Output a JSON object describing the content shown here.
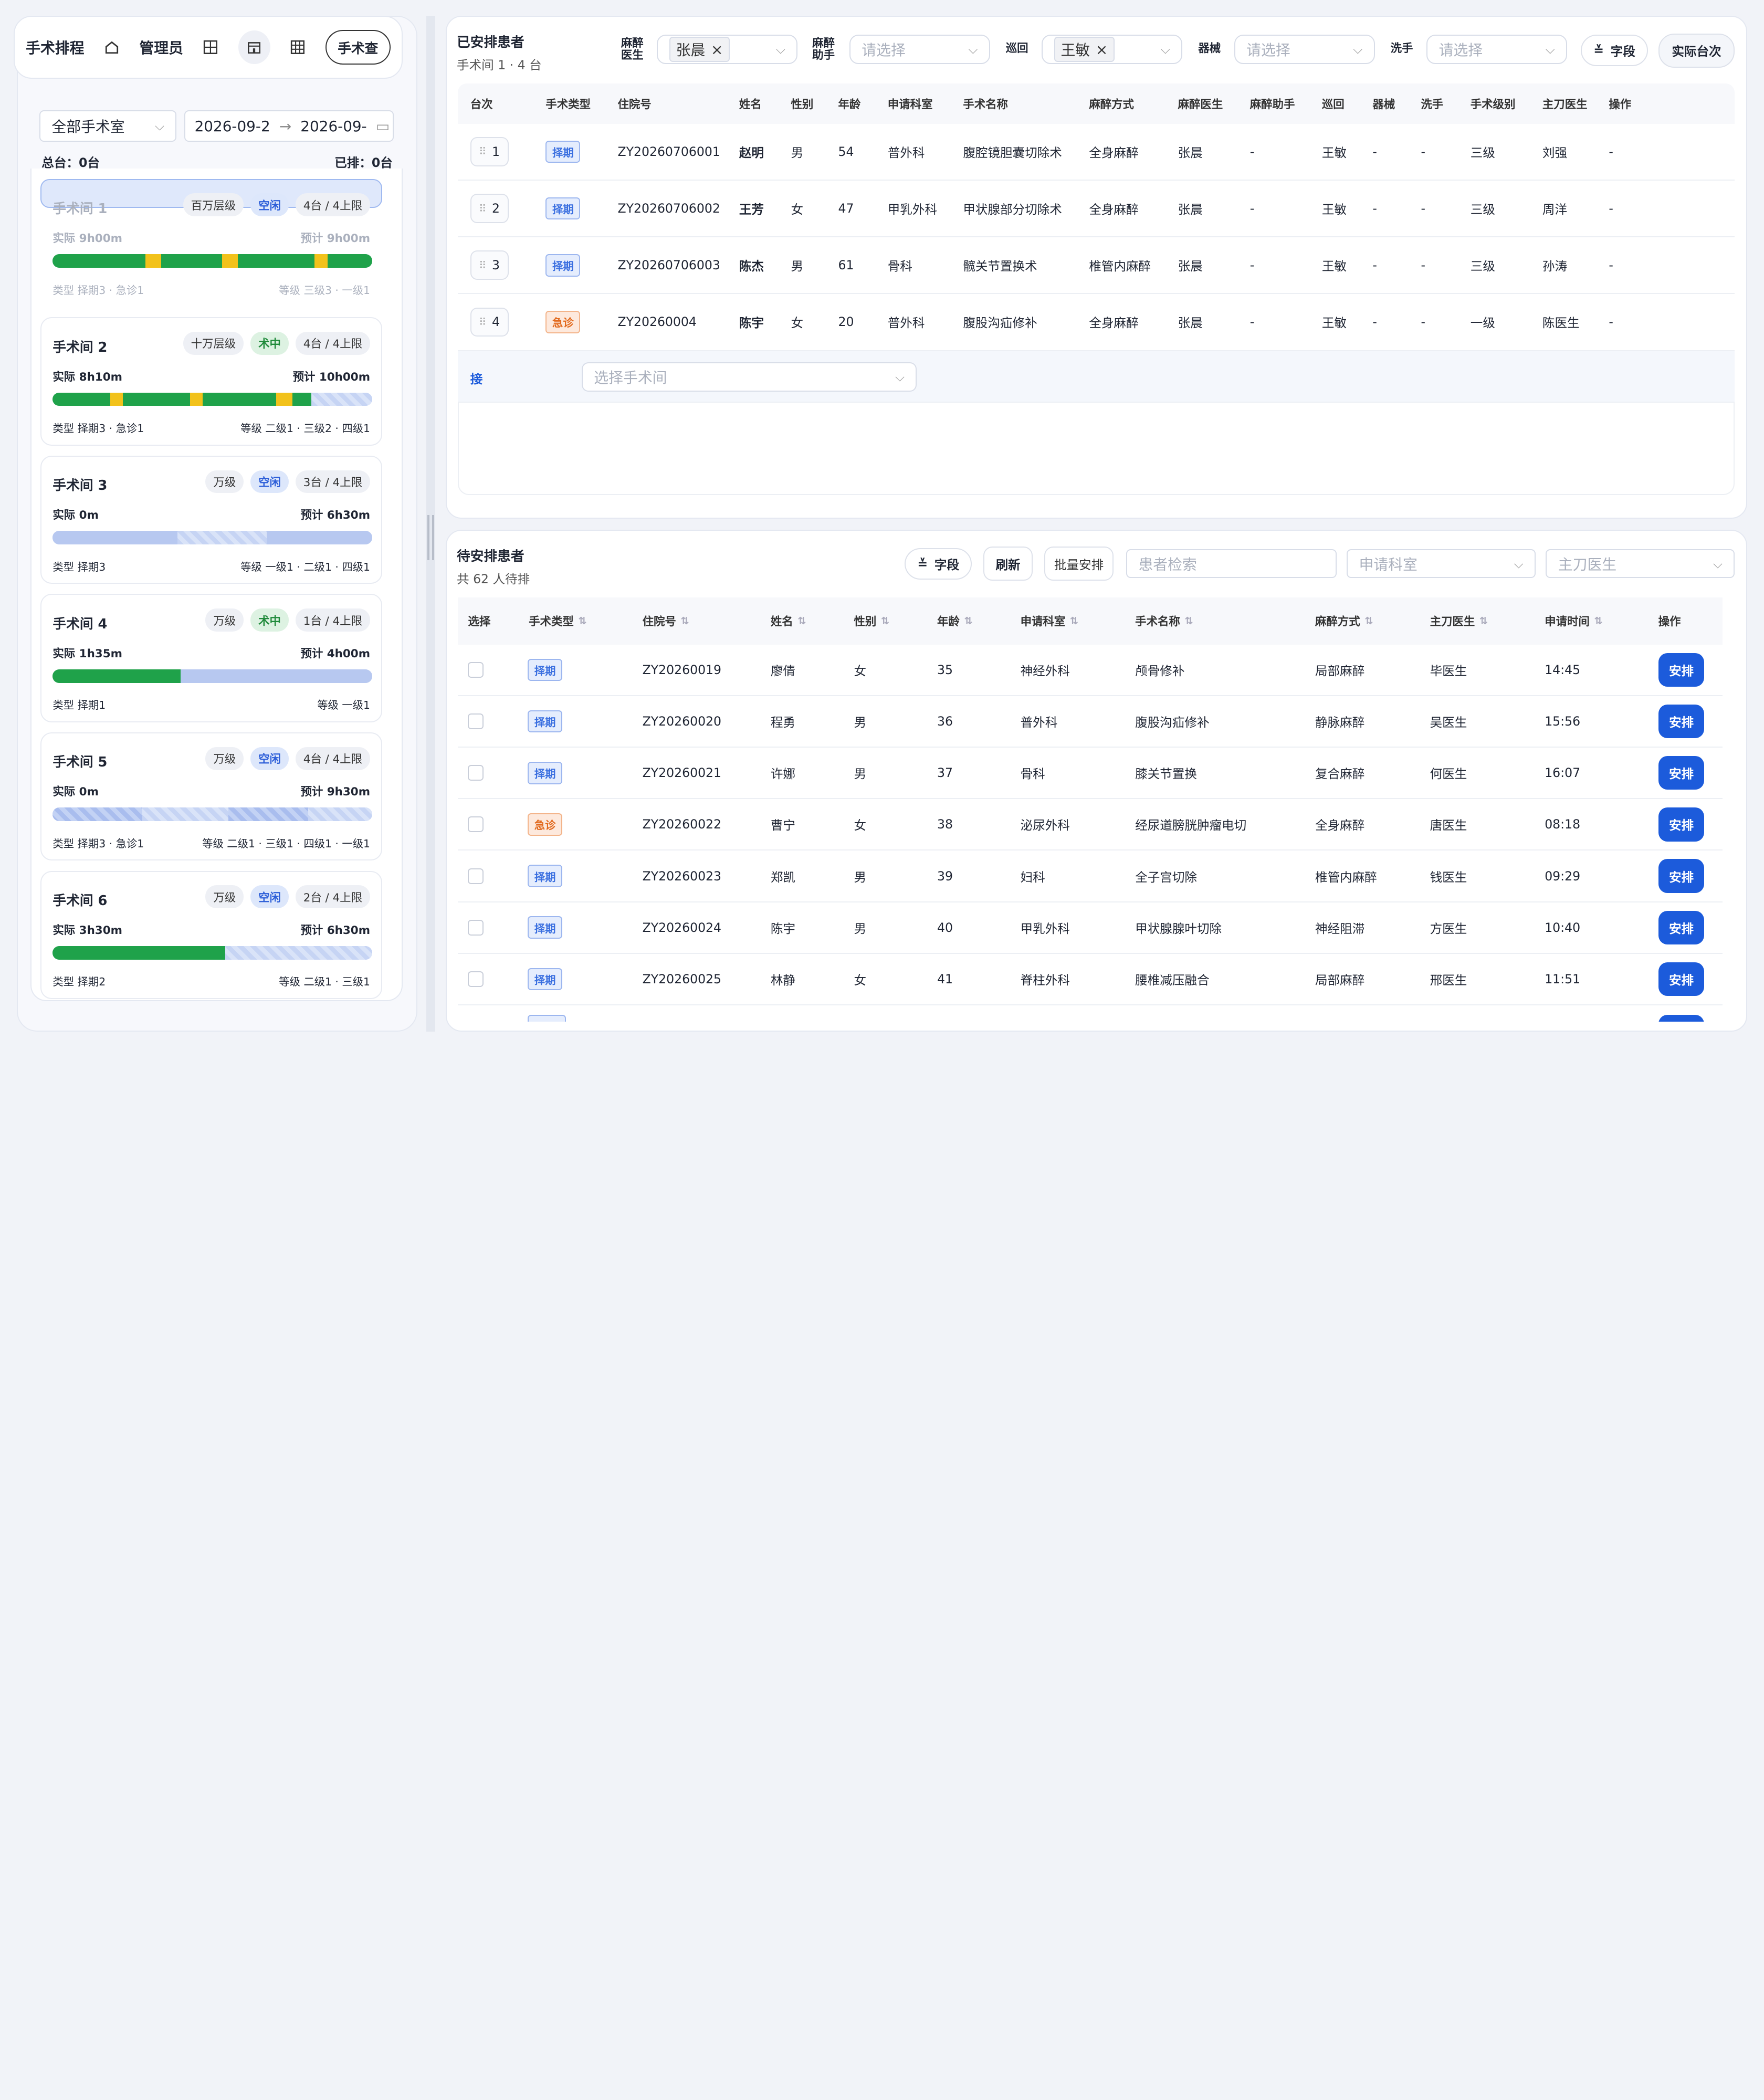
{
  "topbar": {
    "title": "手术排程",
    "home_icon": "home-icon",
    "admin_label": "管理员",
    "grid_icon": "grid-icon",
    "building_icon": "building-icon",
    "table_icon": "table-icon",
    "pill_label": "手术查"
  },
  "filters": {
    "room_select": "全部手术室",
    "date_start": "2026-09-2",
    "date_end": "2026-09-"
  },
  "summary": {
    "total": "总台：0台",
    "scheduled": "已排：0台"
  },
  "rooms": [
    {
      "name": "手术间 1",
      "level": "百万层级",
      "status": "空闲",
      "status_type": "free",
      "capacity": "4台 / 4上限",
      "actual": "实际 9h00m",
      "plan": "预计 9h00m",
      "type": "类型 择期3 · 急诊1",
      "grade": "等级 三级3 · 一级1",
      "selected": true
    },
    {
      "name": "手术间 2",
      "level": "十万层级",
      "status": "术中",
      "status_type": "busy",
      "capacity": "4台 / 4上限",
      "actual": "实际 8h10m",
      "plan": "预计 10h00m",
      "type": "类型 择期3 · 急诊1",
      "grade": "等级 二级1 · 三级2 · 四级1",
      "selected": false
    },
    {
      "name": "手术间 3",
      "level": "万级",
      "status": "空闲",
      "status_type": "free",
      "capacity": "3台 / 4上限",
      "actual": "实际 0m",
      "plan": "预计 6h30m",
      "type": "类型 择期3",
      "grade": "等级 一级1 · 二级1 · 四级1",
      "selected": false
    },
    {
      "name": "手术间 4",
      "level": "万级",
      "status": "术中",
      "status_type": "busy",
      "capacity": "1台 / 4上限",
      "actual": "实际 1h35m",
      "plan": "预计 4h00m",
      "type": "类型 择期1",
      "grade": "等级 一级1",
      "selected": false
    },
    {
      "name": "手术间 5",
      "level": "万级",
      "status": "空闲",
      "status_type": "free",
      "capacity": "4台 / 4上限",
      "actual": "实际 0m",
      "plan": "预计 9h30m",
      "type": "类型 择期3 · 急诊1",
      "grade": "等级 二级1 · 三级1 · 四级1 · 一级1",
      "selected": false
    },
    {
      "name": "手术间 6",
      "level": "万级",
      "status": "空闲",
      "status_type": "free",
      "capacity": "2台 / 4上限",
      "actual": "实际 3h30m",
      "plan": "预计 6h30m",
      "type": "类型 择期2",
      "grade": "等级 二级1 · 三级1",
      "selected": false
    }
  ],
  "scheduled": {
    "title": "已安排患者",
    "subtitle": "手术间 1 · 4 台",
    "filter_labels": {
      "anesth_doctor": "麻醉\n医生",
      "anesth_assist": "麻醉\n助手",
      "tour": "巡回",
      "instrument": "器械",
      "scrub": "洗手"
    },
    "anesth_doctor_value": "张晨",
    "tour_value": "王敏",
    "placeholder": "请选择",
    "fields_button": "字段",
    "actual_button": "实际台次",
    "columns": [
      "台次",
      "手术类型",
      "住院号",
      "姓名",
      "性别",
      "年龄",
      "申请科室",
      "手术名称",
      "麻醉方式",
      "麻醉医生",
      "麻醉助手",
      "巡回",
      "器械",
      "洗手",
      "手术级别",
      "主刀医生",
      "操作"
    ],
    "rows": [
      [
        "1",
        "择期",
        "ZY20260706001",
        "赵明",
        "男",
        "54",
        "普外科",
        "腹腔镜胆囊切除术",
        "全身麻醉",
        "张晨",
        "-",
        "王敏",
        "-",
        "-",
        "三级",
        "刘强",
        "-"
      ],
      [
        "2",
        "择期",
        "ZY20260706002",
        "王芳",
        "女",
        "47",
        "甲乳外科",
        "甲状腺部分切除术",
        "全身麻醉",
        "张晨",
        "-",
        "王敏",
        "-",
        "-",
        "三级",
        "周洋",
        "-"
      ],
      [
        "3",
        "择期",
        "ZY20260706003",
        "陈杰",
        "男",
        "61",
        "骨科",
        "髋关节置换术",
        "椎管内麻醉",
        "张晨",
        "-",
        "王敏",
        "-",
        "-",
        "三级",
        "孙涛",
        "-"
      ],
      [
        "4",
        "急诊",
        "ZY20260004",
        "陈宇",
        "女",
        "20",
        "普外科",
        "腹股沟疝修补",
        "全身麻醉",
        "张晨",
        "-",
        "王敏",
        "-",
        "-",
        "一级",
        "陈医生",
        "-"
      ]
    ],
    "connect_label": "接",
    "connect_placeholder": "选择手术间"
  },
  "pending": {
    "title": "待安排患者",
    "subtitle": "共 62 人待排",
    "fields_button": "字段",
    "refresh_button": "刷新",
    "batch_button": "批量安排",
    "search_placeholder": "患者检索",
    "dept_placeholder": "申请科室",
    "surgeon_placeholder": "主刀医生",
    "columns": [
      "选择",
      "手术类型",
      "住院号",
      "姓名",
      "性别",
      "年龄",
      "申请科室",
      "手术名称",
      "麻醉方式",
      "主刀医生",
      "申请时间",
      "操作"
    ],
    "arrange_label": "安排",
    "rows": [
      [
        "择期",
        "ZY20260019",
        "廖倩",
        "女",
        "35",
        "神经外科",
        "颅骨修补",
        "局部麻醉",
        "毕医生",
        "14:45"
      ],
      [
        "择期",
        "ZY20260020",
        "程勇",
        "男",
        "36",
        "普外科",
        "腹股沟疝修补",
        "静脉麻醉",
        "吴医生",
        "15:56"
      ],
      [
        "择期",
        "ZY20260021",
        "许娜",
        "男",
        "37",
        "骨科",
        "膝关节置换",
        "复合麻醉",
        "何医生",
        "16:07"
      ],
      [
        "急诊",
        "ZY20260022",
        "曹宁",
        "女",
        "38",
        "泌尿外科",
        "经尿道膀胱肿瘤电切",
        "全身麻醉",
        "唐医生",
        "08:18"
      ],
      [
        "择期",
        "ZY20260023",
        "郑凯",
        "男",
        "39",
        "妇科",
        "全子宫切除",
        "椎管内麻醉",
        "钱医生",
        "09:29"
      ],
      [
        "择期",
        "ZY20260024",
        "陈宇",
        "男",
        "40",
        "甲乳外科",
        "甲状腺腺叶切除",
        "神经阻滞",
        "方医生",
        "10:40"
      ],
      [
        "择期",
        "ZY20260025",
        "林静",
        "女",
        "41",
        "脊柱外科",
        "腰椎减压融合",
        "局部麻醉",
        "邢医生",
        "11:51"
      ]
    ]
  },
  "colors": {
    "accent": "#1c5bdb",
    "green": "#1fa24a",
    "yellow": "#f2c21b",
    "sched": "#3a6fe0",
    "emerg": "#e26a1e"
  }
}
